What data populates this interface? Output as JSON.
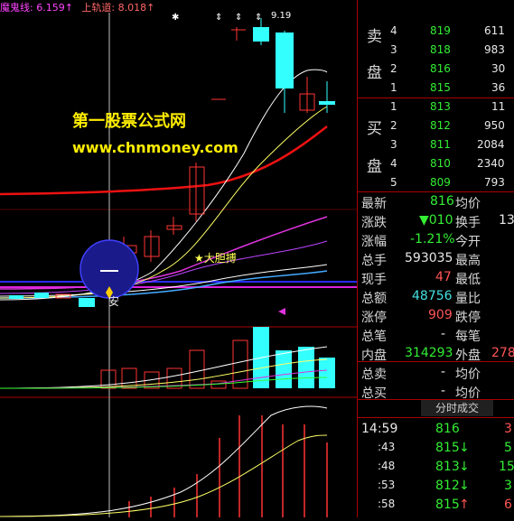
{
  "legend": {
    "ghost_label": "魔鬼线: 6.159↑",
    "upper_label": "上轨道: 8.018↑"
  },
  "watermark": {
    "line1": "第一股票公式网",
    "line2": "www.chnmoney.com"
  },
  "annotations": {
    "star": "★大胆搏",
    "an": "安",
    "peak_price": "9.19"
  },
  "order_book": {
    "sell_label": [
      "卖",
      "盘"
    ],
    "buy_label": [
      "买",
      "盘"
    ],
    "sells": [
      {
        "level": "4",
        "price": "819",
        "vol": "611"
      },
      {
        "level": "3",
        "price": "818",
        "vol": "983"
      },
      {
        "level": "2",
        "price": "816",
        "vol": "30"
      },
      {
        "level": "1",
        "price": "815",
        "vol": "36"
      }
    ],
    "buys": [
      {
        "level": "1",
        "price": "813",
        "vol": "11"
      },
      {
        "level": "2",
        "price": "812",
        "vol": "950"
      },
      {
        "level": "3",
        "price": "811",
        "vol": "2084"
      },
      {
        "level": "4",
        "price": "810",
        "vol": "2340"
      },
      {
        "level": "5",
        "price": "809",
        "vol": "793"
      }
    ]
  },
  "quote": {
    "latest_label": "最新",
    "latest": "816",
    "avg_label": "均价",
    "change_label": "涨跌",
    "change": "▼010",
    "turnover_label": "换手",
    "turnover": "13",
    "pct_label": "涨幅",
    "pct": "-1.21%",
    "open_label": "今开",
    "total_label": "总手",
    "total": "593035",
    "high_label": "最高",
    "cur_label": "现手",
    "cur": "47",
    "low_label": "最低",
    "amount_label": "总额",
    "amount": "48756",
    "ratio_label": "量比",
    "limitup_label": "涨停",
    "limitup": "909",
    "limitdown_label": "跌停",
    "trades_label": "总笔",
    "trades": "-",
    "pertrade_label": "每笔",
    "inner_label": "内盘",
    "inner": "314293",
    "outer_label": "外盘",
    "outer": "278",
    "tsell_label": "总卖",
    "tsell": "-",
    "tsell_avg": "均价",
    "tbuy_label": "总买",
    "tbuy": "-",
    "tbuy_avg": "均价"
  },
  "ticks": {
    "tab_label": "分时成交",
    "rows": [
      {
        "time": "14:59",
        "price": "816",
        "arrow": "",
        "vol": "3"
      },
      {
        "time": ":43",
        "price": "815",
        "arrow": "↓",
        "vol": "5"
      },
      {
        "time": ":48",
        "price": "813",
        "arrow": "↓",
        "vol": "15"
      },
      {
        "time": ":53",
        "price": "812",
        "arrow": "↓",
        "vol": "3"
      },
      {
        "time": ":58",
        "price": "815",
        "arrow": "↑",
        "vol": "6"
      }
    ]
  },
  "colors": {
    "up": "#ff3333",
    "down": "#33ffff",
    "bg": "#000000",
    "grid": "#aa0000",
    "ma_white": "#ffffff",
    "ma_yellow": "#ffff66",
    "ma_magenta": "#dd33dd",
    "ma_red": "#ee1111"
  }
}
